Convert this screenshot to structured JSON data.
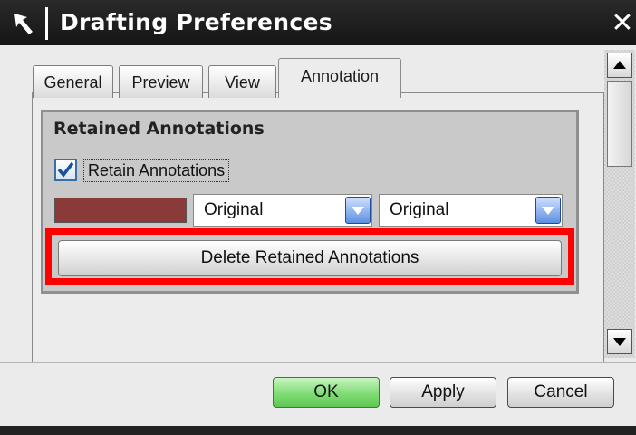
{
  "window": {
    "title": "Drafting Preferences",
    "close_glyph": "✕"
  },
  "tabs": [
    {
      "label": "General",
      "active": false
    },
    {
      "label": "Preview",
      "active": false
    },
    {
      "label": "View",
      "active": false
    },
    {
      "label": "Annotation",
      "active": true
    }
  ],
  "group": {
    "title": "Retained Annotations",
    "checkbox": {
      "label": "Retain Annotations",
      "checked": true
    },
    "color_swatch": "#8b3a3a",
    "select_1": {
      "value": "Original"
    },
    "select_2": {
      "value": "Original"
    },
    "delete_button": "Delete Retained Annotations"
  },
  "footer": {
    "ok": "OK",
    "apply": "Apply",
    "cancel": "Cancel"
  },
  "colors": {
    "highlight": "#ff0000",
    "ok_button": "#7fdc74"
  },
  "icons": {
    "title": "select-arrow-icon",
    "close": "close-icon"
  }
}
